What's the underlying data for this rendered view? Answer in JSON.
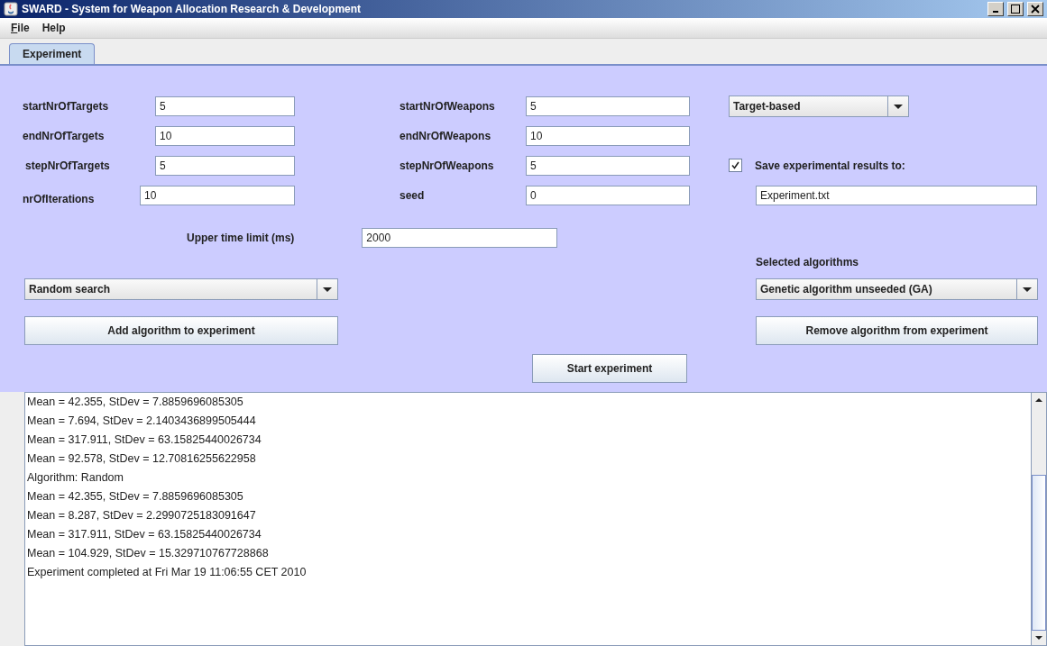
{
  "window": {
    "title": "SWARD - System for Weapon Allocation Research & Development"
  },
  "menu": [
    {
      "label": "File",
      "underlined": true
    },
    {
      "label": "Help",
      "underlined": false
    }
  ],
  "tabs": [
    {
      "label": "Experiment",
      "selected": true
    }
  ],
  "target_params": [
    {
      "label": "startNrOfTargets",
      "value": "5"
    },
    {
      "label": "endNrOfTargets",
      "value": "10"
    },
    {
      "label": "stepNrOfTargets",
      "value": "5"
    },
    {
      "label": "nrOfIterations",
      "value": "10"
    }
  ],
  "weapon_params": [
    {
      "label": "startNrOfWeapons",
      "value": "5"
    },
    {
      "label": "endNrOfWeapons",
      "value": "10"
    },
    {
      "label": "stepNrOfWeapons",
      "value": "5"
    },
    {
      "label": "seed",
      "value": "0"
    }
  ],
  "mode_dropdown": {
    "value": "Target-based"
  },
  "save_results": {
    "checked": true,
    "label": "Save experimental results to:",
    "value": "Experiment.txt"
  },
  "time_limit": {
    "label": "Upper time limit (ms)",
    "value": "2000"
  },
  "algorithm_dropdown": {
    "value": "Random search"
  },
  "selected_algorithms": {
    "label": "Selected algorithms",
    "value": "Genetic algorithm unseeded (GA)"
  },
  "add_button": "Add algorithm to experiment",
  "remove_button": "Remove algorithm from experiment",
  "start_button": "Start experiment",
  "log": [
    "Mean = 42.355, StDev = 7.8859696085305",
    "Mean = 7.694, StDev = 2.1403436899505444",
    "Mean = 317.911, StDev = 63.15825440026734",
    "Mean = 92.578, StDev = 12.70816255622958",
    "Algorithm: Random",
    "Mean = 42.355, StDev = 7.8859696085305",
    "Mean = 8.287, StDev = 2.2990725183091647",
    "Mean = 317.911, StDev = 63.15825440026734",
    "Mean = 104.929, StDev = 15.329710767728868",
    "Experiment completed at Fri Mar 19 11:06:55 CET 2010"
  ]
}
